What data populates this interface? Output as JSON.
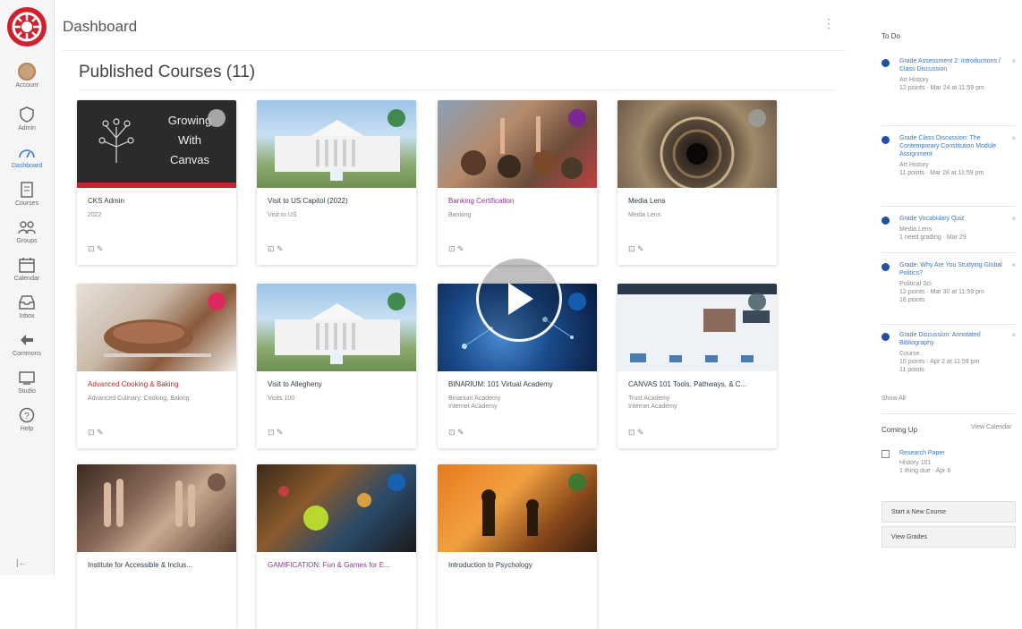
{
  "header": {
    "title": "Dashboard",
    "menu_icon": "⋮"
  },
  "nav": {
    "items": [
      {
        "label": "Account",
        "icon": "account-icon"
      },
      {
        "label": "Admin",
        "icon": "admin-icon"
      },
      {
        "label": "Dashboard",
        "icon": "dashboard-icon"
      },
      {
        "label": "Courses",
        "icon": "courses-icon"
      },
      {
        "label": "Groups",
        "icon": "groups-icon"
      },
      {
        "label": "Calendar",
        "icon": "calendar-icon"
      },
      {
        "label": "Inbox",
        "icon": "inbox-icon"
      },
      {
        "label": "Commons",
        "icon": "commons-icon"
      },
      {
        "label": "Studio",
        "icon": "studio-icon"
      },
      {
        "label": "Help",
        "icon": "help-icon"
      }
    ],
    "collapse": "|←"
  },
  "main": {
    "section_title": "Published Courses (11)"
  },
  "courses": [
    {
      "name": "CKS Admin",
      "code": "2022",
      "color": "#bbbbbb",
      "link_style": ""
    },
    {
      "name": "Visit to US Capitol (2022)",
      "code": "Visit to US",
      "color": "#2e7d32",
      "link_style": ""
    },
    {
      "name": "Banking Certification",
      "code": "Banking",
      "color": "#7b1fa2",
      "link_style": "link"
    },
    {
      "name": "Media Lens",
      "code": "Media Lens",
      "color": "#9e9e9e",
      "link_style": ""
    },
    {
      "name": "Advanced Cooking & Baking",
      "code": "Advanced Culinary: Cooking, Baking",
      "color": "#e91e63",
      "link_style": "red"
    },
    {
      "name": "Visit to Allegheny",
      "code": "Visits 100",
      "color": "#2e7d32",
      "link_style": ""
    },
    {
      "name": "BINARIUM: 101 Virtual Academy",
      "code": "Binarium Academy\nInternet Academy",
      "color": "#1565c0",
      "link_style": ""
    },
    {
      "name": "CANVAS 101 Tools, Pathways, & C...",
      "code": "Trust Academy\nInternet Academy",
      "color": "#455a64",
      "link_style": ""
    },
    {
      "name": "Institute for Accessible & Inclus...",
      "code": "",
      "color": "#6d4c41",
      "link_style": ""
    },
    {
      "name": "GAMIFICATION: Fun & Games for E...",
      "code": "",
      "color": "#1565c0",
      "link_style": "link"
    },
    {
      "name": "Introduction to Psychology",
      "code": "",
      "color": "#2e7d32",
      "link_style": ""
    }
  ],
  "card_banner": {
    "line1": "Growing",
    "line2": "With",
    "line3": "Canvas"
  },
  "card_icons": "⊡ ✎",
  "sidebar": {
    "todo_title": "To Do",
    "todos": [
      {
        "title": "Grade Assessment 2: Introductions / Class Discussion",
        "meta": "Art History\n12 points · Mar 24 at 11:59 pm"
      },
      {
        "title": "Grade Class Discussion: The Contemporary Constitution Module Assignment",
        "meta": "Art History\n11 points · Mar 28 at 11:59 pm"
      },
      {
        "title": "Grade Vocabulary Quiz",
        "meta": "Media Lens\n1 need grading · Mar 29"
      },
      {
        "title": "Grade: Why Are You Studying Global Politics?",
        "meta": "Political Sci\n12 points · Mar 30 at 11:59 pm\n16 points"
      },
      {
        "title": "Grade Discussion: Annotated Bibliography",
        "meta": "Course\n10 points · Apr 2 at 11:59 pm\n11 points"
      }
    ],
    "x": "×",
    "show_all": "Show All",
    "coming_up_title": "Coming Up",
    "calendar_link": "View Calendar",
    "event": {
      "title": "Research Paper",
      "meta": "History 101\n1 thing due · Apr 6"
    },
    "start_button": "Start a New Course",
    "grades_button": "View Grades"
  }
}
